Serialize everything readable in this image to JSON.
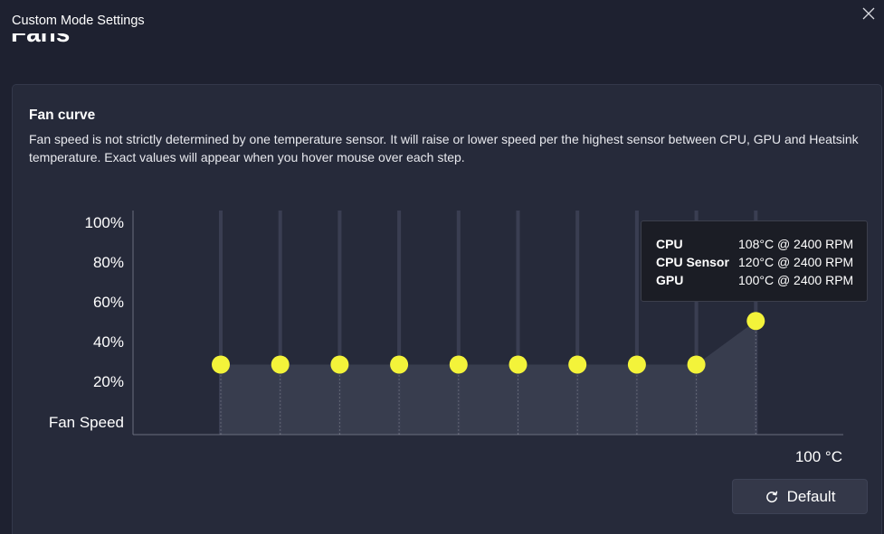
{
  "window": {
    "title": "Custom Mode Settings",
    "close_icon": "close-icon"
  },
  "page": {
    "heading": "Fans"
  },
  "fan_curve": {
    "title": "Fan curve",
    "description": "Fan speed is not strictly determined by one temperature sensor. It will raise or lower speed per the highest sensor between CPU, GPU and Heatsink temperature. Exact values will appear when you hover mouse over each step.",
    "y_axis_title": "Fan Speed",
    "x_axis_label": "100 °C",
    "y_ticks": [
      "100%",
      "80%",
      "60%",
      "40%",
      "20%"
    ],
    "accent_color": "#f3f33a",
    "points": [
      {
        "step": 1,
        "speed_pct": 27
      },
      {
        "step": 2,
        "speed_pct": 27
      },
      {
        "step": 3,
        "speed_pct": 27
      },
      {
        "step": 4,
        "speed_pct": 27
      },
      {
        "step": 5,
        "speed_pct": 27
      },
      {
        "step": 6,
        "speed_pct": 27
      },
      {
        "step": 7,
        "speed_pct": 27
      },
      {
        "step": 8,
        "speed_pct": 27
      },
      {
        "step": 9,
        "speed_pct": 27
      },
      {
        "step": 10,
        "speed_pct": 48
      }
    ],
    "tooltip": [
      {
        "label": "CPU",
        "value": "108°C @ 2400 RPM"
      },
      {
        "label": "CPU Sensor",
        "value": "120°C @ 2400 RPM"
      },
      {
        "label": "GPU",
        "value": "100°C @ 2400 RPM"
      }
    ]
  },
  "default_button": {
    "label": "Default",
    "icon": "reset-icon"
  }
}
